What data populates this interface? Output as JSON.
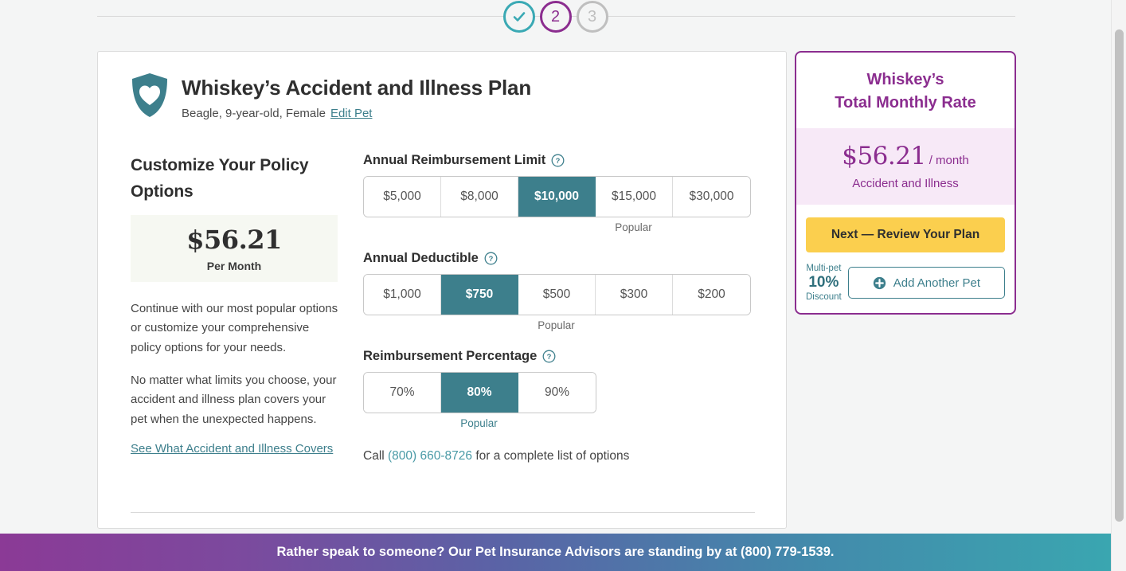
{
  "stepper": {
    "steps": [
      {
        "label": "",
        "state": "done",
        "icon": "check-icon"
      },
      {
        "label": "2",
        "state": "current",
        "icon": ""
      },
      {
        "label": "3",
        "state": "upcoming",
        "icon": ""
      }
    ]
  },
  "plan": {
    "icon": "shield-heart-icon",
    "title": "Whiskey’s Accident and Illness Plan",
    "pet_meta": "Beagle, 9-year-old, Female",
    "edit_pet_label": "Edit Pet"
  },
  "left": {
    "section_title": "Customize Your Policy Options",
    "price_amount": "$56.21",
    "price_period": "Per Month",
    "paragraph_1": "Continue with our most popular options or customize your comprehensive policy options for your needs.",
    "paragraph_2": "No matter what limits you choose, your accident and illness plan covers your pet when the unexpected happens.",
    "covers_link": "See What Accident and Illness Covers"
  },
  "options": {
    "reimbursement_limit": {
      "label": "Annual Reimbursement Limit",
      "help_icon": "question-circle-icon",
      "choices": [
        "$5,000",
        "$8,000",
        "$10,000",
        "$15,000",
        "$30,000"
      ],
      "selected_index": 2,
      "popular_index": 3,
      "popular_label": "Popular",
      "popular_teal": false
    },
    "deductible": {
      "label": "Annual Deductible",
      "help_icon": "question-circle-icon",
      "choices": [
        "$1,000",
        "$750",
        "$500",
        "$300",
        "$200"
      ],
      "selected_index": 1,
      "popular_index": 2,
      "popular_label": "Popular",
      "popular_teal": false
    },
    "reimbursement_percentage": {
      "label": "Reimbursement Percentage",
      "help_icon": "question-circle-icon",
      "choices": [
        "70%",
        "80%",
        "90%"
      ],
      "selected_index": 1,
      "popular_index": 1,
      "popular_label": "Popular",
      "popular_teal": true
    },
    "call_prefix": "Call",
    "call_phone": "(800) 660-8726",
    "call_suffix": "for a complete list of options"
  },
  "summary": {
    "title_line_1": "Whiskey’s",
    "title_line_2": "Total Monthly Rate",
    "amount": "$56.21",
    "per": "/ month",
    "plan_type": "Accident and Illness",
    "next_button": "Next — Review Your Plan",
    "multi_pet_top": "Multi-pet",
    "multi_pet_percent": "10%",
    "multi_pet_bottom": "Discount",
    "add_pet_button": "Add Another Pet",
    "add_pet_icon": "plus-circle-icon"
  },
  "banner": {
    "text": "Rather speak to someone? Our Pet Insurance Advisors are standing by at (800) 779-1539."
  },
  "colors": {
    "teal": "#3d7f8c",
    "teal_light": "#3aa9b4",
    "purple": "#8b2d8f",
    "yellow": "#fbcf4e",
    "price_bg": "#f6f8f2",
    "summary_price_bg": "#f7e9f7"
  }
}
